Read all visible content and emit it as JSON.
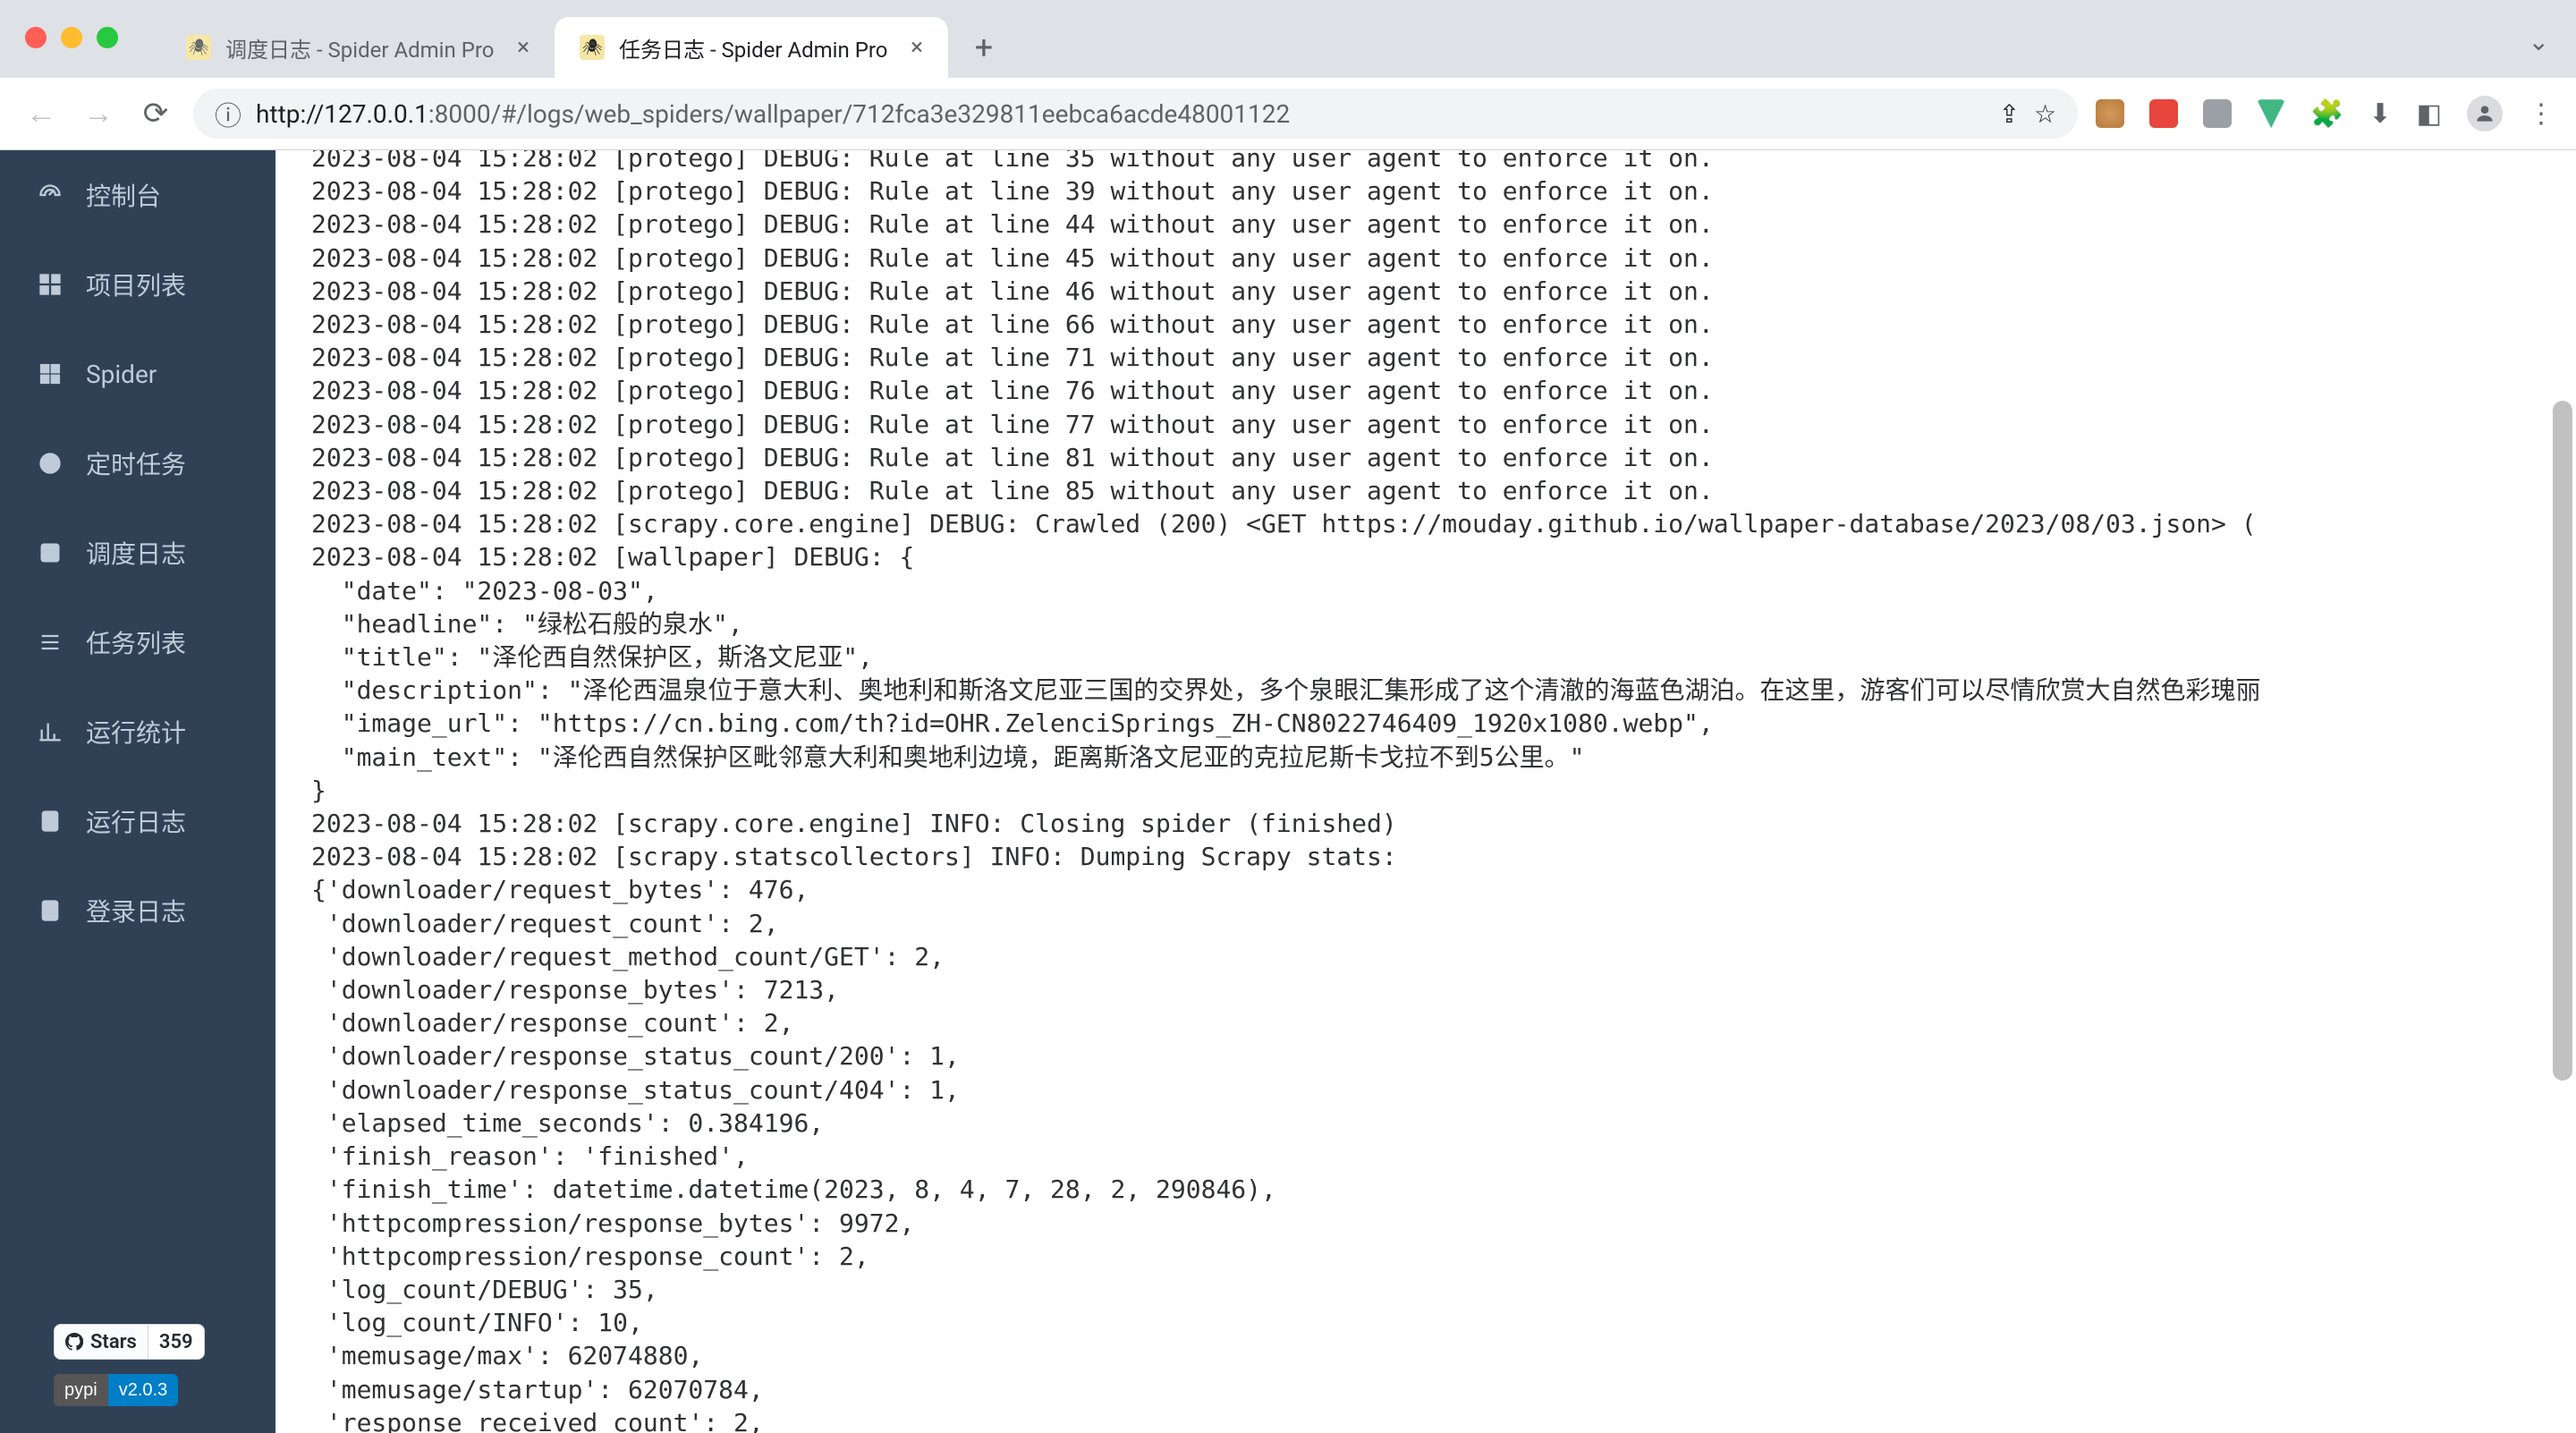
{
  "browser": {
    "tabs": [
      {
        "title": "调度日志 - Spider Admin Pro",
        "active": false
      },
      {
        "title": "任务日志 - Spider Admin Pro",
        "active": true
      }
    ],
    "url_display": {
      "proto_host": "127.0.0.1",
      "port": ":8000",
      "path": "/#/logs/web_spiders/wallpaper/712fca3e329811eebca6acde48001122",
      "full": "http://127.0.0.1:8000/#/logs/web_spiders/wallpaper/712fca3e329811eebca6acde48001122"
    }
  },
  "sidebar": {
    "items": [
      {
        "label": "控制台",
        "icon": "dashboard-icon"
      },
      {
        "label": "项目列表",
        "icon": "grid-icon"
      },
      {
        "label": "Spider",
        "icon": "tiles-icon"
      },
      {
        "label": "定时任务",
        "icon": "clock-icon"
      },
      {
        "label": "调度日志",
        "icon": "schedule-log-icon"
      },
      {
        "label": "任务列表",
        "icon": "list-icon"
      },
      {
        "label": "运行统计",
        "icon": "stats-icon"
      },
      {
        "label": "运行日志",
        "icon": "run-log-icon"
      },
      {
        "label": "登录日志",
        "icon": "login-log-icon"
      }
    ]
  },
  "badges": {
    "github_label": "Stars",
    "github_count": "359",
    "pypi_label": "pypi",
    "pypi_version": "v2.0.3"
  },
  "log_text": "2023-08-04 15:28:02 [protego] DEBUG: Rule at line 35 without any user agent to enforce it on.\n2023-08-04 15:28:02 [protego] DEBUG: Rule at line 39 without any user agent to enforce it on.\n2023-08-04 15:28:02 [protego] DEBUG: Rule at line 44 without any user agent to enforce it on.\n2023-08-04 15:28:02 [protego] DEBUG: Rule at line 45 without any user agent to enforce it on.\n2023-08-04 15:28:02 [protego] DEBUG: Rule at line 46 without any user agent to enforce it on.\n2023-08-04 15:28:02 [protego] DEBUG: Rule at line 66 without any user agent to enforce it on.\n2023-08-04 15:28:02 [protego] DEBUG: Rule at line 71 without any user agent to enforce it on.\n2023-08-04 15:28:02 [protego] DEBUG: Rule at line 76 without any user agent to enforce it on.\n2023-08-04 15:28:02 [protego] DEBUG: Rule at line 77 without any user agent to enforce it on.\n2023-08-04 15:28:02 [protego] DEBUG: Rule at line 81 without any user agent to enforce it on.\n2023-08-04 15:28:02 [protego] DEBUG: Rule at line 85 without any user agent to enforce it on.\n2023-08-04 15:28:02 [scrapy.core.engine] DEBUG: Crawled (200) <GET https://mouday.github.io/wallpaper-database/2023/08/03.json> (\n2023-08-04 15:28:02 [wallpaper] DEBUG: {\n  \"date\": \"2023-08-03\",\n  \"headline\": \"绿松石般的泉水\",\n  \"title\": \"泽伦西自然保护区，斯洛文尼亚\",\n  \"description\": \"泽伦西温泉位于意大利、奥地利和斯洛文尼亚三国的交界处，多个泉眼汇集形成了这个清澈的海蓝色湖泊。在这里，游客们可以尽情欣赏大自然色彩瑰丽\n  \"image_url\": \"https://cn.bing.com/th?id=OHR.ZelenciSprings_ZH-CN8022746409_1920x1080.webp\",\n  \"main_text\": \"泽伦西自然保护区毗邻意大利和奥地利边境，距离斯洛文尼亚的克拉尼斯卡戈拉不到5公里。\"\n}\n2023-08-04 15:28:02 [scrapy.core.engine] INFO: Closing spider (finished)\n2023-08-04 15:28:02 [scrapy.statscollectors] INFO: Dumping Scrapy stats:\n{'downloader/request_bytes': 476,\n 'downloader/request_count': 2,\n 'downloader/request_method_count/GET': 2,\n 'downloader/response_bytes': 7213,\n 'downloader/response_count': 2,\n 'downloader/response_status_count/200': 1,\n 'downloader/response_status_count/404': 1,\n 'elapsed_time_seconds': 0.384196,\n 'finish_reason': 'finished',\n 'finish_time': datetime.datetime(2023, 8, 4, 7, 28, 2, 290846),\n 'httpcompression/response_bytes': 9972,\n 'httpcompression/response_count': 2,\n 'log_count/DEBUG': 35,\n 'log_count/INFO': 10,\n 'memusage/max': 62074880,\n 'memusage/startup': 62070784,\n 'response_received_count': 2,\n"
}
